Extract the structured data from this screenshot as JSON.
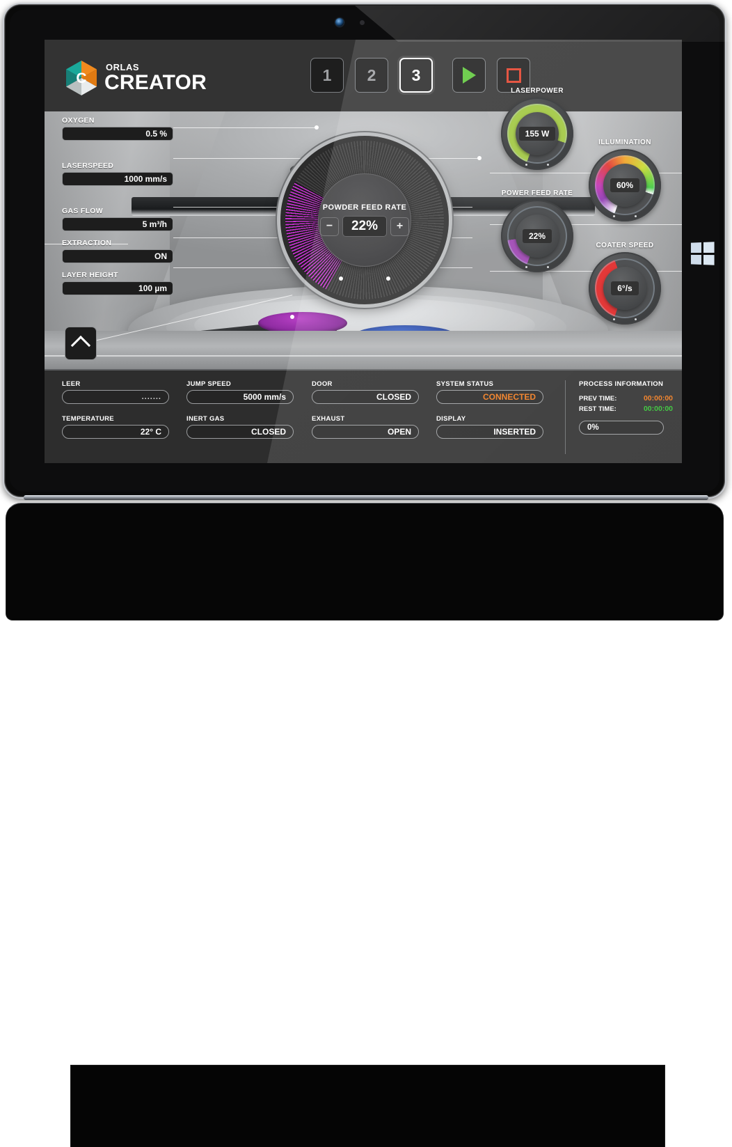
{
  "device": {
    "brand_icon": "windows-logo",
    "camera_icon": "camera-lens"
  },
  "app": {
    "logo_top": "ORLAS",
    "logo_main": "CREATOR"
  },
  "nav": {
    "buttons": [
      {
        "label": "1",
        "active": false
      },
      {
        "label": "2",
        "active": false
      },
      {
        "label": "3",
        "active": true
      }
    ],
    "play_label": "play-button",
    "stop_label": "stop-button"
  },
  "params_left": [
    {
      "label": "OXYGEN",
      "value": "0.5 %"
    },
    {
      "label": "LASERSPEED",
      "value": "1000 mm/s"
    },
    {
      "label": "GAS FLOW",
      "value": "5 m³/h"
    },
    {
      "label": "EXTRACTION",
      "value": "ON"
    },
    {
      "label": "LAYER HEIGHT",
      "value": "100 µm"
    }
  ],
  "collapse_button": {
    "icon": "chevron-up-icon"
  },
  "center_dial": {
    "label": "POWDER FEED RATE",
    "value": "22%",
    "minus": "−",
    "plus": "+",
    "arc_color": "#c832d2"
  },
  "gauges": [
    {
      "name": "LASERPOWER",
      "value": "155 W",
      "color": "#9ec63b"
    },
    {
      "name": "ILLUMINATION",
      "value": "60%",
      "color": "rainbow"
    },
    {
      "name": "POWER FEED RATE",
      "value": "22%",
      "color": "#9b3fb0"
    },
    {
      "name": "COATER SPEED",
      "value": "6°/s",
      "color": "#e02020"
    }
  ],
  "status_fields": [
    {
      "label": "LEER",
      "value": "......."
    },
    {
      "label": "TEMPERATURE",
      "value": "22° C"
    },
    {
      "label": "JUMP SPEED",
      "value": "5000 mm/s"
    },
    {
      "label": "INERT GAS",
      "value": "CLOSED"
    },
    {
      "label": "DOOR",
      "value": "CLOSED"
    },
    {
      "label": "EXHAUST",
      "value": "OPEN"
    },
    {
      "label": "SYSTEM STATUS",
      "value": "CONNECTED",
      "accent": "#f07818"
    },
    {
      "label": "DISPLAY",
      "value": "INSERTED"
    }
  ],
  "process_information": {
    "title": "PROCESS INFORMATION",
    "prev_time_label": "PREV TIME:",
    "prev_time_value": "00:00:00",
    "rest_time_label": "REST TIME:",
    "rest_time_value": "00:00:00",
    "progress_value": "0%"
  }
}
